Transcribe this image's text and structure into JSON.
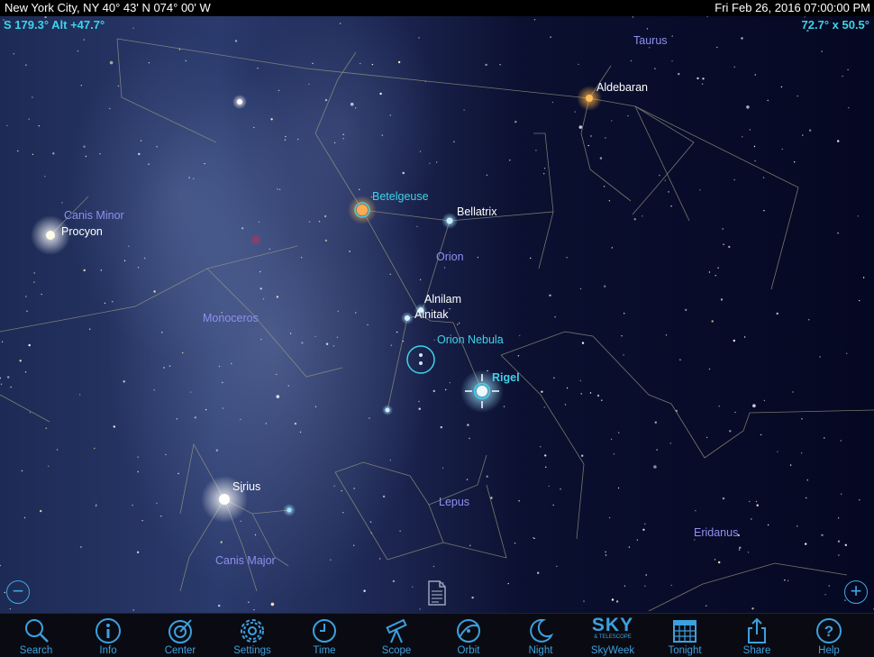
{
  "status_bar": {
    "location": "New York City, NY  40° 43' N 074° 00' W",
    "datetime": "Fri Feb 26, 2016  07:00:00 PM"
  },
  "view": {
    "azimuth_altitude": "S 179.3° Alt +47.7°",
    "field_of_view": "72.7° x 50.5°"
  },
  "constellations": [
    "Taurus",
    "Canis Minor",
    "Orion",
    "Monoceros",
    "Lepus",
    "Canis Major",
    "Eridanus"
  ],
  "objects": {
    "aldebaran": "Aldebaran",
    "betelgeuse": "Betelgeuse",
    "bellatrix": "Bellatrix",
    "procyon": "Procyon",
    "alnilam": "Alnilam",
    "alnitak": "Alnitak",
    "orion_nebula": "Orion Nebula",
    "rigel": "Rigel",
    "sirius": "Sirius"
  },
  "toolbar": [
    {
      "label": "Search",
      "icon": "magnifier-icon"
    },
    {
      "label": "Info",
      "icon": "info-icon"
    },
    {
      "label": "Center",
      "icon": "center-target-icon"
    },
    {
      "label": "Settings",
      "icon": "gear-icon"
    },
    {
      "label": "Time",
      "icon": "clock-icon"
    },
    {
      "label": "Scope",
      "icon": "telescope-icon"
    },
    {
      "label": "Orbit",
      "icon": "orbit-icon"
    },
    {
      "label": "Night",
      "icon": "crescent-moon-icon"
    },
    {
      "label": "SkyWeek",
      "icon": "sky-telescope-logo"
    },
    {
      "label": "Tonight",
      "icon": "calendar-grid-icon"
    },
    {
      "label": "Share",
      "icon": "share-icon"
    },
    {
      "label": "Help",
      "icon": "help-icon"
    }
  ],
  "logo": {
    "text": "SKY",
    "subtext": "& TELESCOPE"
  },
  "colors": {
    "accent": "#3fd3e8",
    "toolbar_icon": "#3da0df",
    "constellation_label": "#8f8ff0"
  }
}
